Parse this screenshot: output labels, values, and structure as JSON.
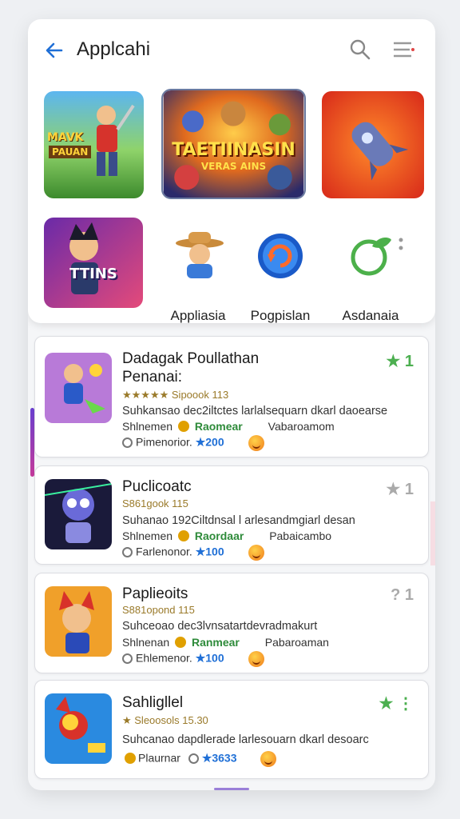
{
  "header": {
    "title": "Applcahi"
  },
  "featured": [
    {
      "name": "tile-adventure",
      "caption_top": "MAVK",
      "caption": "PAUAN"
    },
    {
      "name": "tile-battle",
      "caption": "TAETIINASIN",
      "subcaption": "VERAS AINS"
    },
    {
      "name": "tile-rocket"
    },
    {
      "name": "tile-titans",
      "caption": "TTINS"
    }
  ],
  "quick_apps": [
    {
      "label": "Appliasia"
    },
    {
      "label": "Pogpislan"
    },
    {
      "label": "Asdanaia"
    }
  ],
  "list": [
    {
      "title_line1": "Dadagak Poullathan",
      "title_line2": "Penanai:",
      "meta": "★★★★★ Sipoook 113",
      "desc": "Suhkansao dec2iltctes larlalsequarn dkarl daoearse",
      "row1_left": "Shlnemen",
      "row1_green": "Raomear",
      "row1_right": "Vabaroamom",
      "row2_left": "Pimenorior.",
      "row2_price": "★200",
      "rating": "1",
      "rating_color": "#4caf50"
    },
    {
      "title_line1": "Puclicoatc",
      "meta": "S861gook 115",
      "desc": "Suhanao 192Ciltdnsal l arlesandmgiarl desan",
      "row1_left": "Shlnemen",
      "row1_green": "Raordaar",
      "row1_right": "Pabaicambo",
      "row2_left": "Farlenonor.",
      "row2_price": "★100",
      "rating": "1",
      "rating_color": "#aaaaaa"
    },
    {
      "title_line1": "Paplieoits",
      "meta": "S881opond 115",
      "desc": "Suhceoao dec3lvnsatartdevradmakurt",
      "row1_left": "Shlnenan",
      "row1_green": "Ranmear",
      "row1_right": "Pabaroaman",
      "row2_left": "Ehlemenor.",
      "row2_price": "★100",
      "rating": "1",
      "rating_color": "#aaaaaa"
    },
    {
      "title_line1": "Sahligllel",
      "meta": "★ Sleoosols 15.30",
      "desc": "Suhcanao dapdlerade larlesouarn dkarl desoarc",
      "row1_left": "Plaurnar",
      "row1_price": "★3633",
      "rating": "⋮",
      "rating_color": "#4caf50"
    }
  ],
  "colors": {
    "accent_blue": "#1f6fd6",
    "green": "#2e8b3a",
    "star": "#f2a500"
  }
}
